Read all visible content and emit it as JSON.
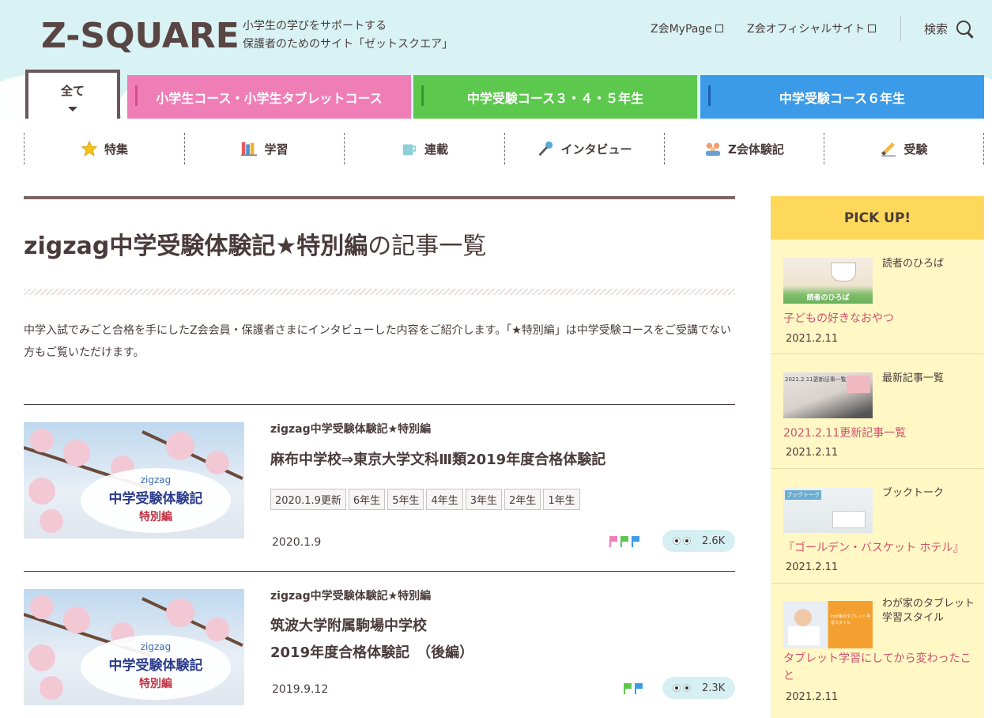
{
  "header": {
    "logo": "Z-SQUARE",
    "tagline_line1": "小学生の学びをサポートする",
    "tagline_line2": "保護者のためのサイト「ゼットスクエア」",
    "link_mypage": "Z会MyPage",
    "link_official": "Z会オフィシャルサイト",
    "search_label": "検索"
  },
  "tabs": {
    "all": "全て",
    "elementary": "小学生コース・小学生タブレットコース",
    "juken345": "中学受験コース３・４・５年生",
    "juken6": "中学受験コース６年生"
  },
  "subnav": [
    {
      "label": "特集",
      "icon": "star-icon"
    },
    {
      "label": "学習",
      "icon": "books-icon"
    },
    {
      "label": "連載",
      "icon": "mug-icon"
    },
    {
      "label": "インタビュー",
      "icon": "microphone-icon"
    },
    {
      "label": "Z会体験記",
      "icon": "people-icon"
    },
    {
      "label": "受験",
      "icon": "pencil-icon"
    }
  ],
  "main": {
    "title_bold": "zigzag中学受験体験記★特別編",
    "title_suffix": "の記事一覧",
    "intro": "中学入試でみごと合格を手にしたZ会会員・保護者さまにインタビューした内容をご紹介します。「★特別編」は中学受験コースをご受講でない方もご覧いただけます。",
    "thumb_text": {
      "zig": "zigzag",
      "main": "中学受験体験記",
      "special": "特別編"
    },
    "articles": [
      {
        "category": "zigzag中学受験体験記★特別編",
        "title": "麻布中学校⇒東京大学文科Ⅲ類2019年度合格体験記",
        "tags": [
          "2020.1.9更新",
          "6年生",
          "5年生",
          "4年生",
          "3年生",
          "2年生",
          "1年生"
        ],
        "date": "2020.1.9",
        "views": "2.6K"
      },
      {
        "category": "zigzag中学受験体験記★特別編",
        "title_line1": "筑波大学附属駒場中学校",
        "title_line2": "2019年度合格体験記　（後編）",
        "date": "2019.9.12",
        "views": "2.3K"
      }
    ]
  },
  "sidebar": {
    "heading": "PICK UP!",
    "items": [
      {
        "category": "読者のひろば",
        "title": "子どもの好きなおやつ",
        "date": "2021.2.11",
        "thumb_caption": "読者のひろば"
      },
      {
        "category": "最新記事一覧",
        "title": "2021.2.11更新記事一覧",
        "date": "2021.2.11",
        "thumb_caption": "2021.2.11更新記事一覧"
      },
      {
        "category": "ブックトーク",
        "title": "『ゴールデン・バスケット ホテル』",
        "date": "2021.2.11",
        "thumb_caption": "ブックトーク"
      },
      {
        "category": "わが家のタブレット学習スタイル",
        "title": "タブレット学習にしてから変わったこと",
        "date": "2021.2.11",
        "thumb_caption": "わが家のタブレット学習スタイル"
      }
    ]
  },
  "colors": {
    "pink_tab": "#f07eb6",
    "green_tab": "#5dc84e",
    "blue_tab": "#3c9be8",
    "pickup_head": "#fed85a",
    "pickup_bg": "#fff7c4",
    "link_pink": "#d05070"
  }
}
